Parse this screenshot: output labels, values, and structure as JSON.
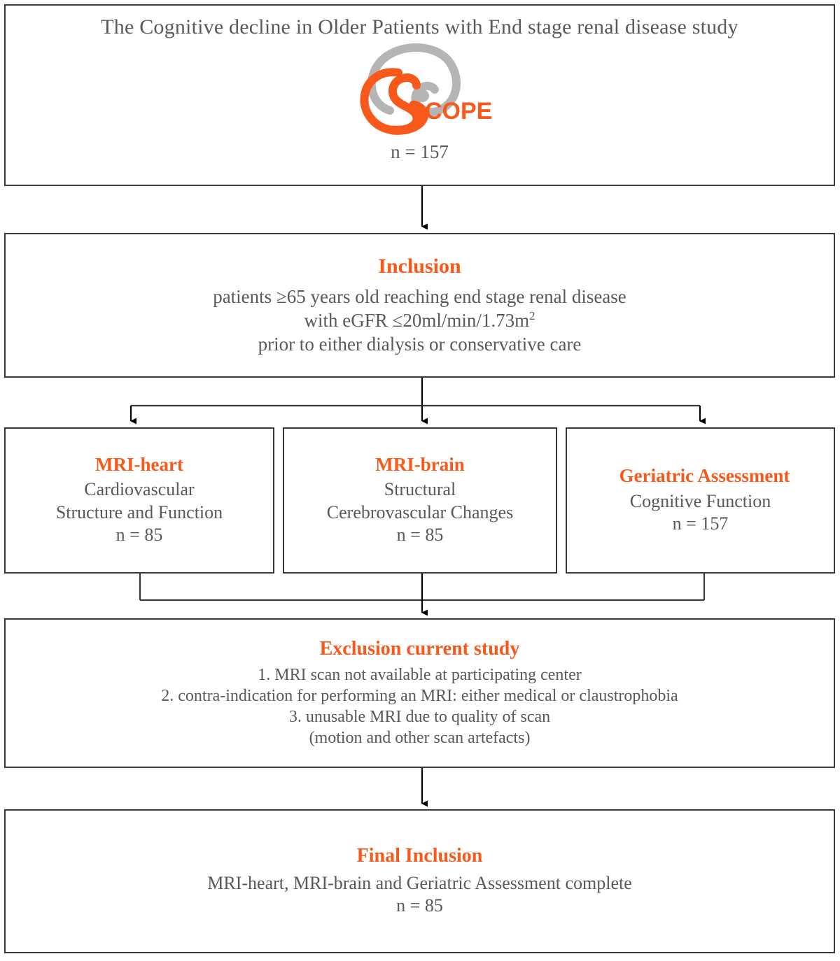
{
  "accent_color": "#F8591B",
  "text_color": "#595959",
  "border_color": "#3a3a3a",
  "study_box": {
    "title": "The Cognitive decline in Older Patients with End stage renal disease study",
    "logo_label": "COPE",
    "n_label": "n = 157"
  },
  "inclusion_box": {
    "heading": "Inclusion",
    "line1": "patients ≥65 years old reaching end stage renal disease",
    "line2_prefix": "with eGFR ≤20ml/min/1.73m",
    "line2_sup": "2",
    "line3": "prior to either dialysis or conservative care"
  },
  "arms": [
    {
      "heading": "MRI-heart",
      "line1": "Cardiovascular",
      "line2": "Structure and Function",
      "n_label": "n = 85"
    },
    {
      "heading": "MRI-brain",
      "line1": "Structural",
      "line2": "Cerebrovascular Changes",
      "n_label": "n = 85"
    },
    {
      "heading": "Geriatric Assessment",
      "line1": "Cognitive Function",
      "n_label": "n = 157"
    }
  ],
  "exclusion_box": {
    "heading": "Exclusion current study",
    "item1": "1. MRI scan not available at participating center",
    "item2": "2. contra-indication for performing an MRI: either medical or claustrophobia",
    "item3": "3. unusable MRI due to quality of scan",
    "item4": "(motion and other scan artefacts)"
  },
  "final_box": {
    "heading": "Final Inclusion",
    "line1": "MRI-heart, MRI-brain and Geriatric Assessment complete",
    "n_label": "n = 85"
  }
}
